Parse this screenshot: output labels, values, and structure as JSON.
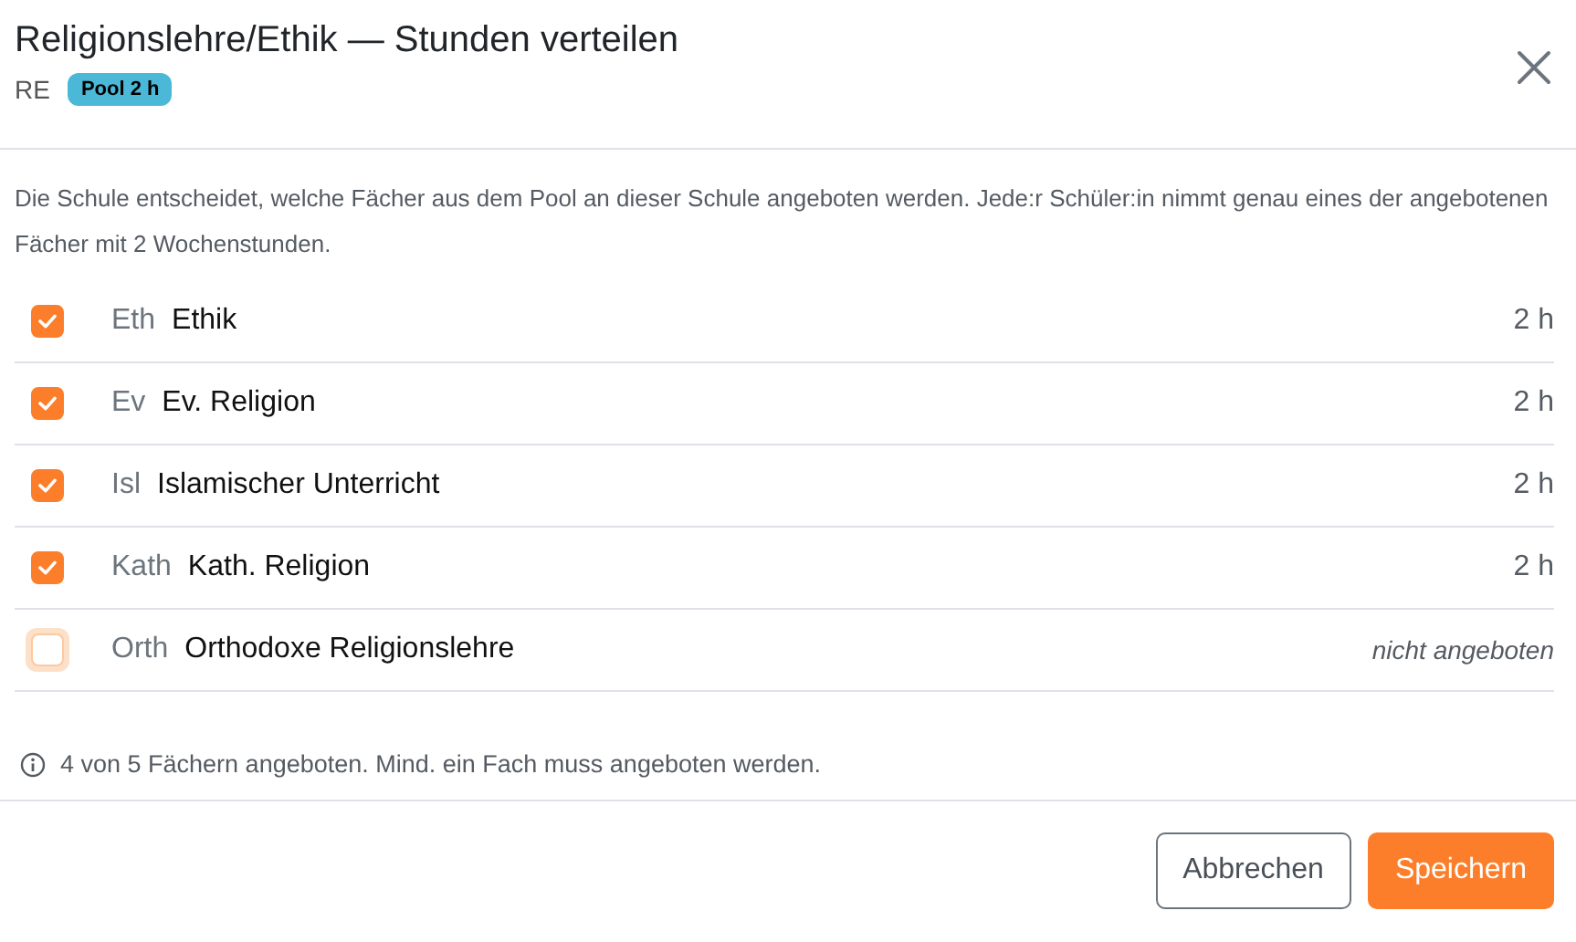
{
  "dialog": {
    "title": "Religionslehre/Ethik — Stunden verteilen",
    "code": "RE",
    "badge": "Pool 2 h"
  },
  "description": "Die Schule entscheidet, welche Fächer aus dem Pool an dieser Schule angeboten werden. Jede:r Schüler:in nimmt genau eines der angebotenen Fächer mit 2 Wochenstunden.",
  "subjects": [
    {
      "abbr": "Eth",
      "name": "Ethik",
      "hours": "2 h",
      "checked": true,
      "focused": false
    },
    {
      "abbr": "Ev",
      "name": "Ev. Religion",
      "hours": "2 h",
      "checked": true,
      "focused": false
    },
    {
      "abbr": "Isl",
      "name": "Islamischer Unterricht",
      "hours": "2 h",
      "checked": true,
      "focused": false
    },
    {
      "abbr": "Kath",
      "name": "Kath. Religion",
      "hours": "2 h",
      "checked": true,
      "focused": false
    },
    {
      "abbr": "Orth",
      "name": "Orthodoxe Religionslehre",
      "hours": "nicht angeboten",
      "checked": false,
      "focused": true
    }
  ],
  "note": "4 von 5 Fächern angeboten. Mind. ein Fach muss angeboten werden.",
  "buttons": [
    {
      "label": "Abbrechen",
      "kind": "secondary"
    },
    {
      "label": "Speichern",
      "kind": "primary"
    }
  ]
}
